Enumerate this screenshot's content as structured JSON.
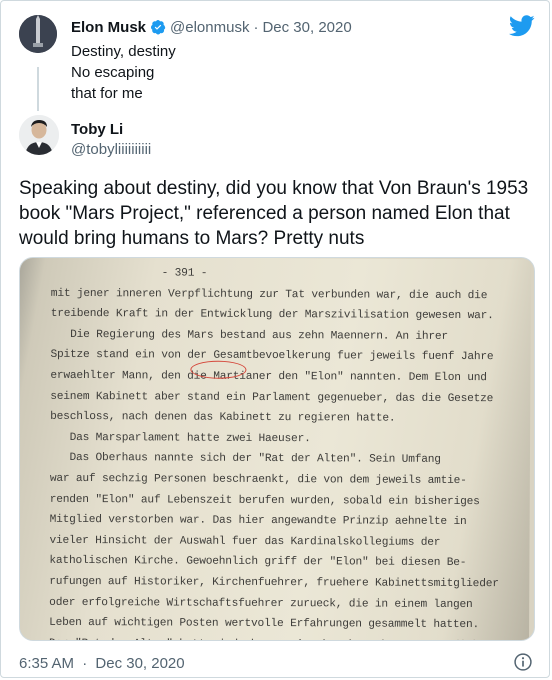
{
  "quoted": {
    "name": "Elon Musk",
    "handle": "@elonmusk",
    "separator": "·",
    "date": "Dec 30, 2020",
    "text": "Destiny, destiny\nNo escaping\nthat for me"
  },
  "tweet": {
    "name": "Toby Li",
    "handle": "@tobyliiiiiiiiii",
    "text": "Speaking about destiny, did you know that Von Braun's 1953 book \"Mars Project,\" referenced a person named Elon that would bring humans to Mars? Pretty nuts",
    "time": "6:35 AM",
    "separator": "·",
    "date": "Dec 30, 2020"
  },
  "document": {
    "lines": [
      "                 - 391 -",
      "mit jener inneren Verpflichtung zur Tat verbunden war, die auch die",
      "treibende Kraft in der Entwicklung der Marszivilisation gewesen war.",
      "   Die Regierung des Mars bestand aus zehn Maennern. An ihrer",
      "Spitze stand ein von der Gesamtbevoelkerung fuer jeweils fuenf Jahre",
      "erwaehlter Mann, den die Martianer den \"Elon\" nannten. Dem Elon und",
      "seinem Kabinett aber stand ein Parlament gegenueber, das die Gesetze",
      "beschloss, nach denen das Kabinett zu regieren hatte.",
      "   Das Marsparlament hatte zwei Haeuser.",
      "   Das Oberhaus nannte sich der \"Rat der Alten\". Sein Umfang",
      "war auf sechzig Personen beschraenkt, die von dem jeweils amtie-",
      "renden \"Elon\" auf Lebenszeit berufen wurden, sobald ein bisheriges",
      "Mitglied verstorben war. Das hier angewandte Prinzip aehnelte in",
      "vieler Hinsicht der Auswahl fuer das Kardinalskollegiums der",
      "katholischen Kirche. Gewoehnlich griff der \"Elon\" bei diesen Be-",
      "rufungen auf Historiker, Kirchenfuehrer, fruehere Kabinettsmitglieder",
      "oder erfolgreiche Wirtschaftsfuehrer zurueck, die in einem langen",
      "Leben auf wichtigen Posten wertvolle Erfahrungen gesammelt hatten.",
      "Der \"Rat der Alten\" hatte jedoch nur eine beschraenkte Zustaendigkeit:"
    ]
  },
  "icons": {
    "brand": "twitter-bird-icon",
    "verified": "verified-badge-icon",
    "info": "info-icon"
  },
  "colors": {
    "brand_blue": "#1d9bf0",
    "secondary_text": "#536471",
    "highlight_circle": "#d5483c"
  }
}
